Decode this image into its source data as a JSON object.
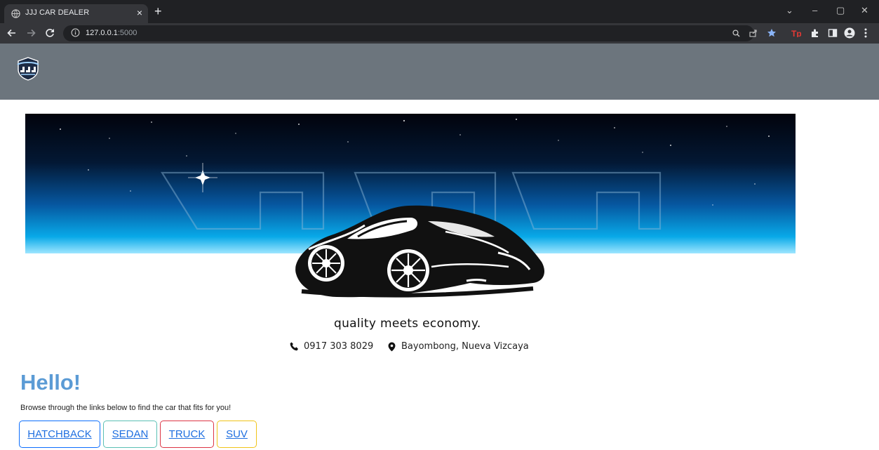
{
  "browser": {
    "tab_title": "JJJ CAR DEALER",
    "tab_close": "×",
    "new_tab": "+",
    "url_host": "127.0.0.1",
    "url_port": ":5000",
    "window_controls": [
      "⌄",
      "–",
      "▢",
      "✕"
    ]
  },
  "hero": {
    "tagline": "quality meets economy."
  },
  "contact": {
    "phone": "0917 303 8029",
    "location": "Bayombong, Nueva Vizcaya"
  },
  "main": {
    "heading": "Hello!",
    "lead": "Browse through the links below to find the car that fits for you!",
    "categories": [
      {
        "label": "HATCHBACK",
        "color": "#0d6efd"
      },
      {
        "label": "SEDAN",
        "color": "#5bc0b4"
      },
      {
        "label": "TRUCK",
        "color": "#dc3545"
      },
      {
        "label": "SUV",
        "color": "#f0c419"
      }
    ]
  },
  "colors": {
    "navbar": "#6c757d",
    "heading": "#5b9bd5",
    "link": "#1f6fe0"
  }
}
